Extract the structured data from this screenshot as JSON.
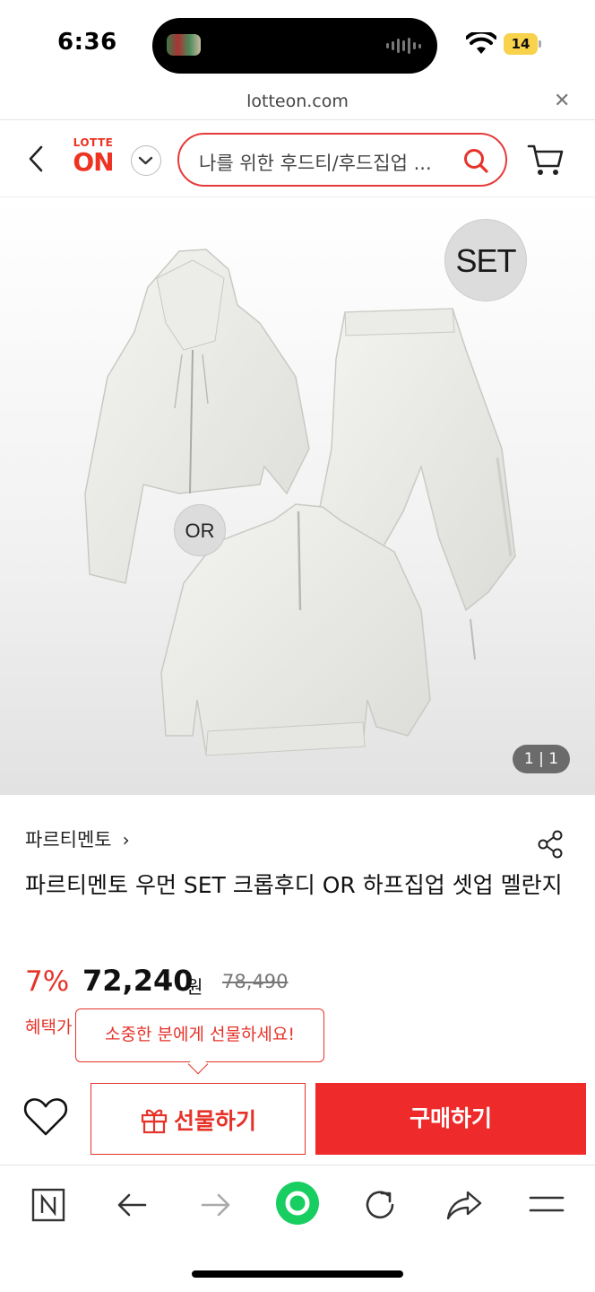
{
  "status_bar": {
    "time": "6:36",
    "battery": "14"
  },
  "url_bar": {
    "url": "lotteon.com"
  },
  "header": {
    "logo_top": "LOTTE",
    "logo_main": "ON",
    "search_placeholder": "나를 위한 후드티/후드집업 ..."
  },
  "product_image": {
    "badge_set": "SET",
    "badge_or": "OR",
    "counter": "1 | 1"
  },
  "product": {
    "brand": "파르티멘토",
    "title": "파르티멘토 우먼 SET 크롭후디 OR 하프집업 셋업 멜란지",
    "discount": "7%",
    "price": "72,240",
    "currency": "원",
    "original_price": "78,490",
    "benefit_label": "혜택가"
  },
  "tooltip": {
    "text": "소중한 분에게 선물하세요!"
  },
  "actions": {
    "gift_label": "선물하기",
    "buy_label": "구매하기"
  },
  "colors": {
    "accent": "#e6332a",
    "buy_button": "#ee2a2a",
    "naver_green": "#19ce60"
  }
}
